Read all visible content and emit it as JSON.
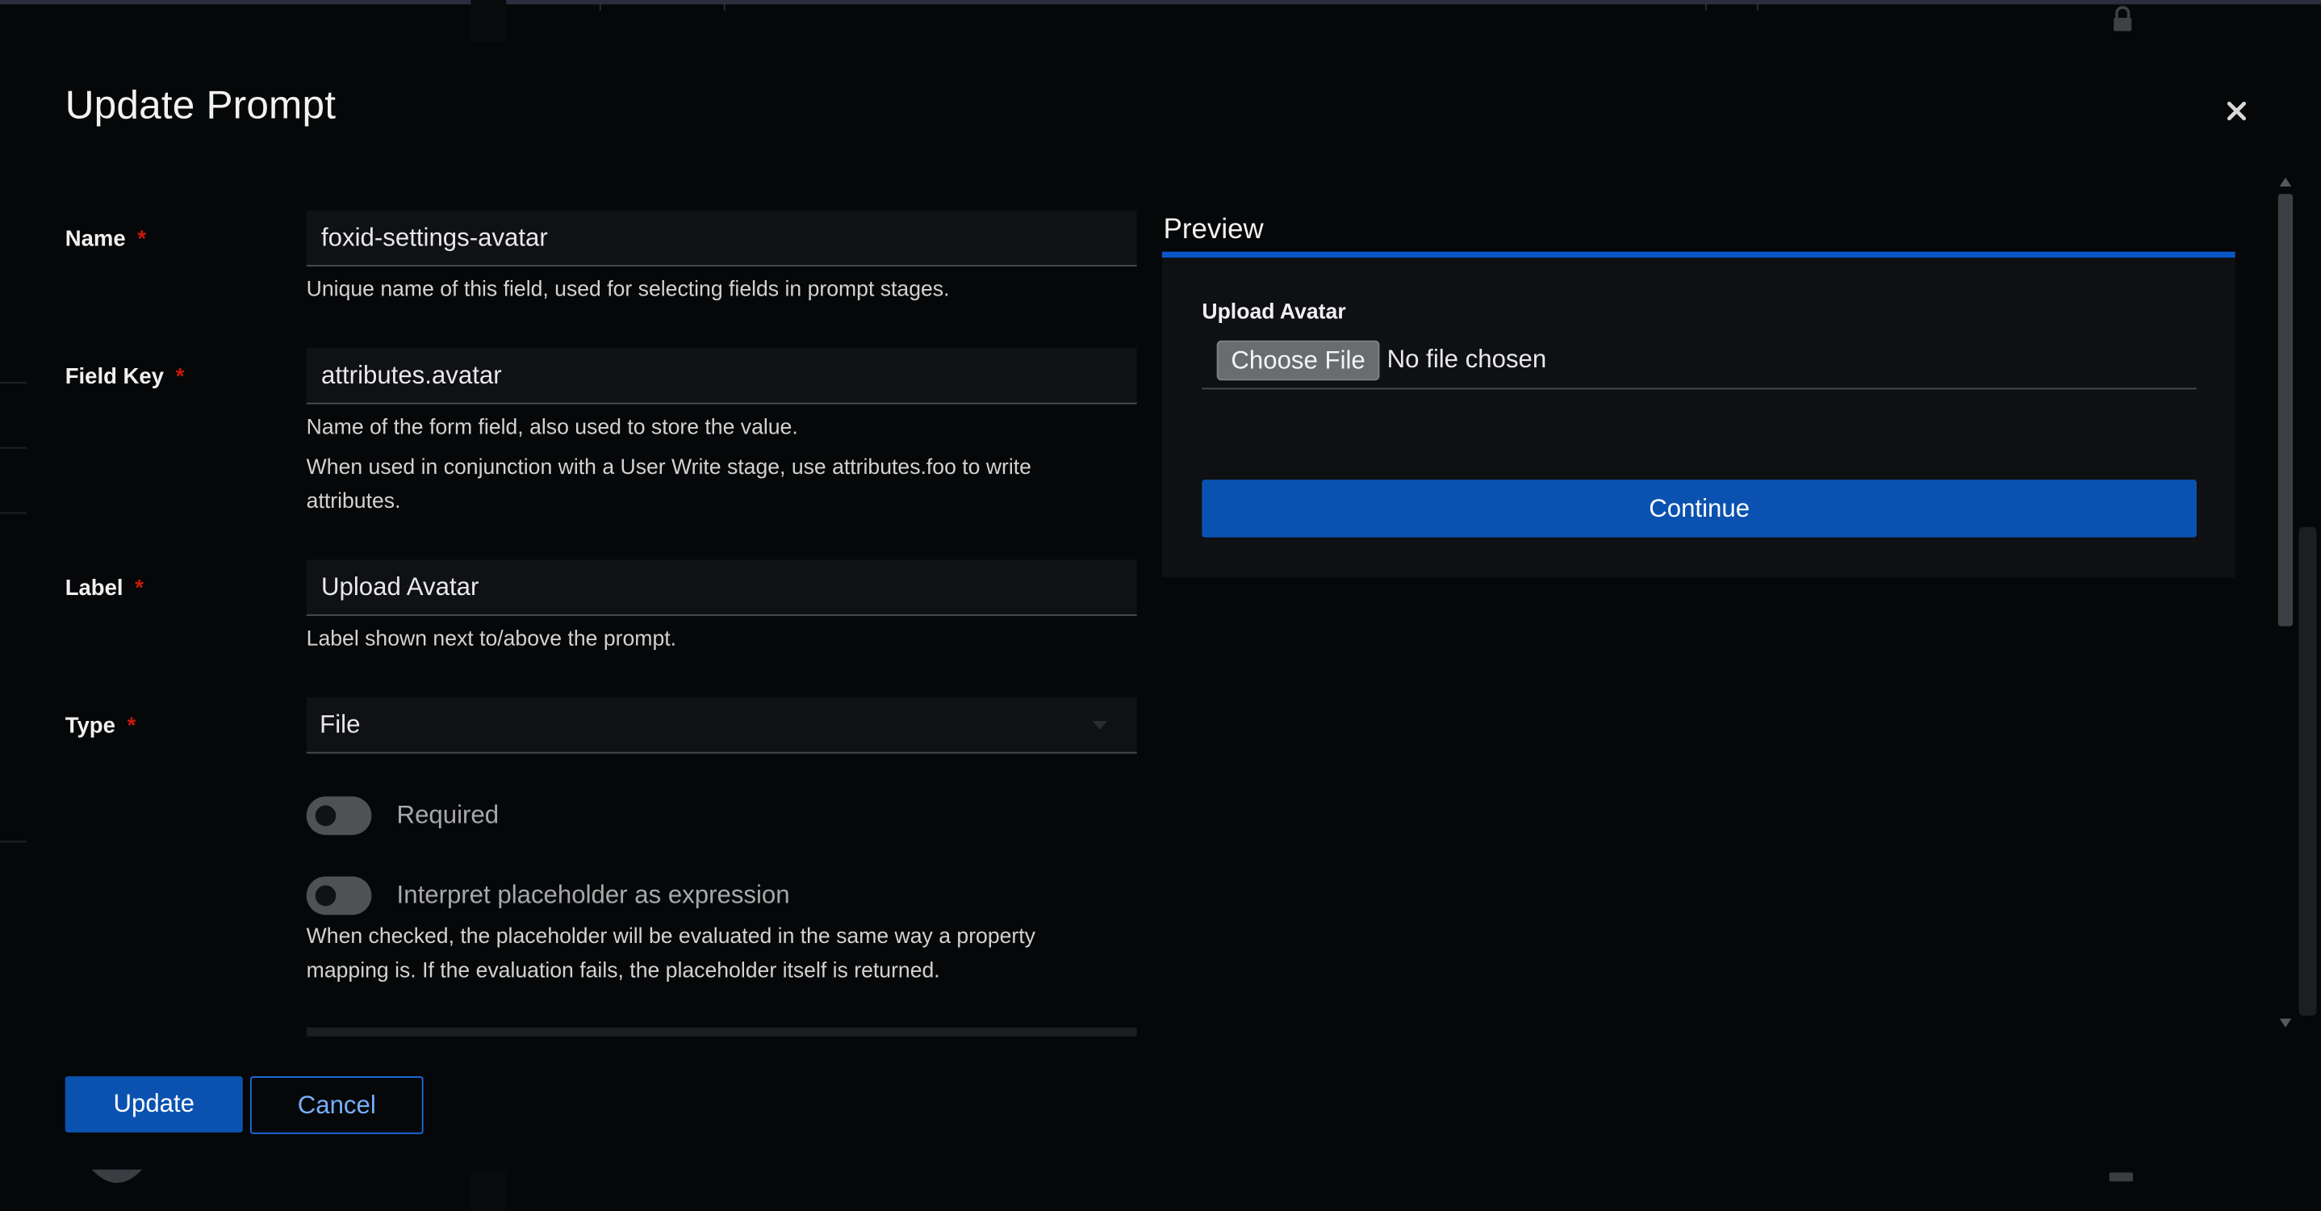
{
  "modal": {
    "title": "Update Prompt"
  },
  "form": {
    "name": {
      "label": "Name",
      "required_mark": "*",
      "value": "foxid-settings-avatar",
      "helper": "Unique name of this field, used for selecting fields in prompt stages."
    },
    "field_key": {
      "label": "Field Key",
      "required_mark": "*",
      "value": "attributes.avatar",
      "helper_1": "Name of the form field, also used to store the value.",
      "helper_2": "When used in conjunction with a User Write stage, use attributes.foo to write attributes."
    },
    "label": {
      "label": "Label",
      "required_mark": "*",
      "value": "Upload Avatar",
      "helper": "Label shown next to/above the prompt."
    },
    "type": {
      "label": "Type",
      "required_mark": "*",
      "value": "File"
    },
    "required_toggle": {
      "label": "Required",
      "checked": false
    },
    "placeholder_expression_toggle": {
      "label": "Interpret placeholder as expression",
      "checked": false,
      "helper": "When checked, the placeholder will be evaluated in the same way a property mapping is. If the evaluation fails, the placeholder itself is returned."
    }
  },
  "actions": {
    "update_label": "Update",
    "cancel_label": "Cancel"
  },
  "preview": {
    "title": "Preview",
    "field_label": "Upload Avatar",
    "choose_file_label": "Choose File",
    "file_status": "No file chosen",
    "continue_label": "Continue"
  },
  "colors": {
    "primary": "#0b52b0",
    "required_asterisk": "#c9190b",
    "accent_border": "#0a56c8",
    "link_text": "#76aefc"
  },
  "icons": {
    "close": "close-icon",
    "caret": "caret-down-icon",
    "lock": "lock-icon"
  }
}
